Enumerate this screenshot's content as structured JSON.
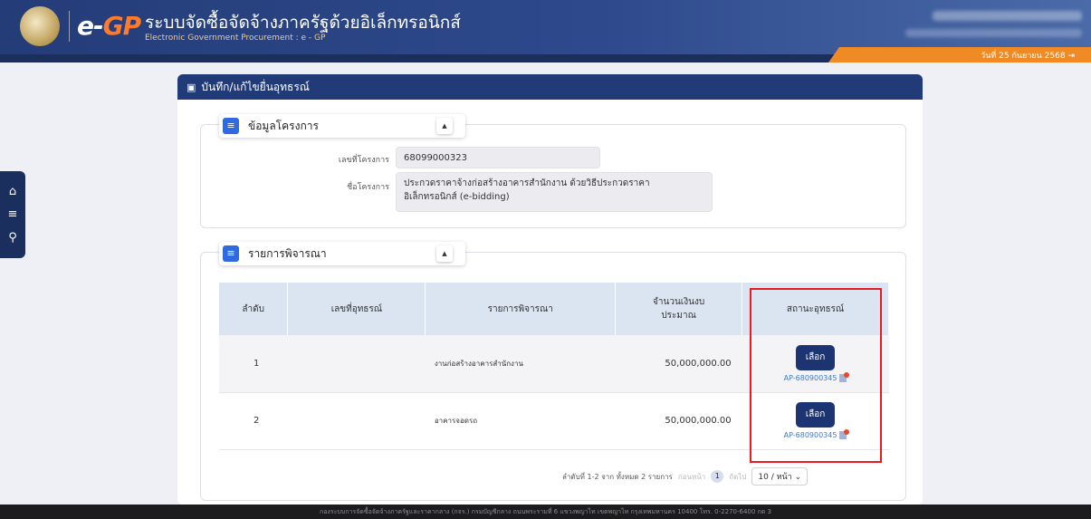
{
  "header": {
    "logo_e": "e-",
    "logo_gp": "GP",
    "title": "ระบบจัดซื้อจัดจ้างภาครัฐด้วยอิเล็กทรอนิกส์",
    "subtitle": "Electronic Government Procurement : e - GP",
    "date": "วันที่ 25 กันยายน 2568"
  },
  "side_menu": [
    "home-icon",
    "menu-icon",
    "search-icon"
  ],
  "panel": {
    "title": "บันทึก/แก้ไขยื่นอุทธรณ์"
  },
  "project_section": {
    "label": "ข้อมูลโครงการ",
    "fields": {
      "project_no_label": "เลขที่โครงการ",
      "project_no": "68099000323",
      "project_name_label": "ชื่อโครงการ",
      "project_name": "ประกวดราคาจ้างก่อสร้างอาคารสำนักงาน ด้วยวิธีประกวดราคา อิเล็กทรอนิกส์ (e-bidding)"
    }
  },
  "items_section": {
    "label": "รายการพิจารณา",
    "columns": [
      "ลำดับ",
      "เลขที่อุทธรณ์",
      "รายการพิจารณา",
      "จำนวนเงินงบประมาณ",
      "สถานะอุทธรณ์"
    ],
    "rows": [
      {
        "no": "1",
        "appeal_no": "",
        "item": "งานก่อสร้างอาคารสำนักงาน",
        "budget": "50,000,000.00",
        "button": "เลือก",
        "link": "AP-680900345"
      },
      {
        "no": "2",
        "appeal_no": "",
        "item": "อาคารจอดรถ",
        "budget": "50,000,000.00",
        "button": "เลือก",
        "link": "AP-680900345"
      }
    ],
    "pager": {
      "summary": "ลำดับที่ 1-2 จาก ทั้งหมด 2 รายการ",
      "prev": "ก่อนหน้า",
      "page": "1",
      "next": "ถัดไป",
      "page_size": "10 / หน้า"
    }
  },
  "footer": {
    "text": "กองระบบการจัดซื้อจัดจ้างภาครัฐและราคากลาง (กจร.) กรมบัญชีกลาง ถนนพระรามที่ 6 แขวงพญาไท เขตพญาไท กรุงเทพมหานคร 10400 โทร. 0-2270-6400 กด 3"
  },
  "colors": {
    "header": "#243c78",
    "accent_orange": "#f08a24",
    "button_navy": "#1d3473",
    "highlight_red": "#e51c23"
  }
}
